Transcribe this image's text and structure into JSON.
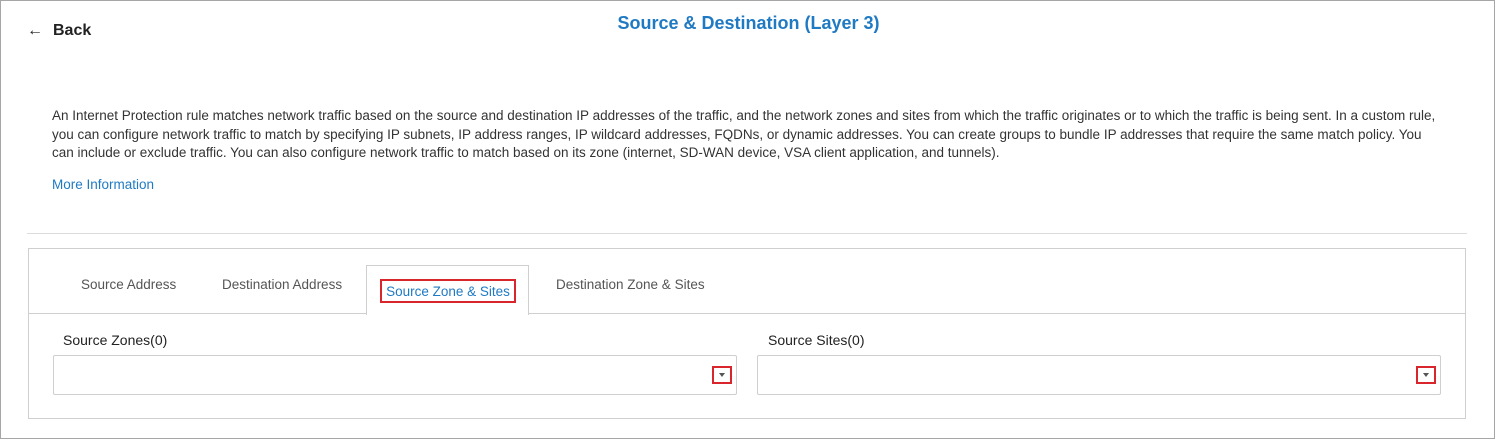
{
  "header": {
    "back_label": "Back",
    "back_icon": "arrow-left-icon",
    "title": "Source & Destination (Layer 3)"
  },
  "description": {
    "text": "An Internet Protection rule matches network traffic based on the source and destination IP addresses of the traffic, and the network zones and sites from which the traffic originates or to which the traffic is being sent. In a custom rule, you can configure network traffic to match by specifying IP subnets, IP address ranges, IP wildcard addresses, FQDNs, or dynamic addresses. You can create groups to bundle IP addresses that require the same match policy. You can include or exclude traffic. You can also configure network traffic to match based on its zone (internet, SD-WAN device, VSA client application, and tunnels).",
    "more_info_label": "More Information"
  },
  "tabs": [
    {
      "label": "Source Address",
      "active": false
    },
    {
      "label": "Destination Address",
      "active": false
    },
    {
      "label": "Source Zone & Sites",
      "active": true
    },
    {
      "label": "Destination Zone & Sites",
      "active": false
    }
  ],
  "fields": {
    "source_zones": {
      "label": "Source Zones(0)",
      "value": "",
      "icon": "chevron-down-icon"
    },
    "source_sites": {
      "label": "Source Sites(0)",
      "value": "",
      "icon": "chevron-down-icon"
    }
  },
  "colors": {
    "accent": "#1f7ac3",
    "highlight": "#d9262c"
  }
}
